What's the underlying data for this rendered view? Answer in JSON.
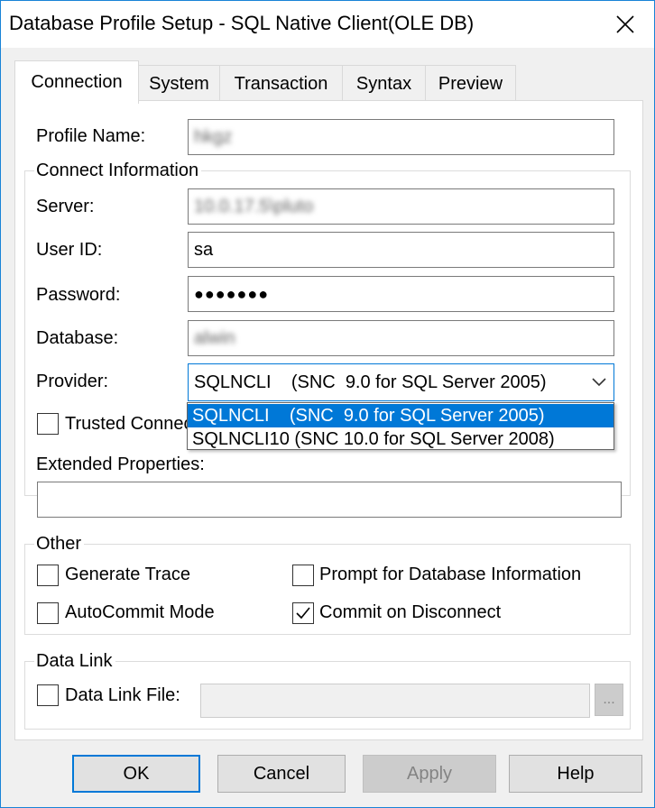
{
  "window": {
    "title": "Database Profile Setup - SQL Native Client(OLE DB)",
    "close_icon": "close-icon"
  },
  "tabs": [
    {
      "label": "Connection",
      "active": true
    },
    {
      "label": "System",
      "active": false
    },
    {
      "label": "Transaction",
      "active": false
    },
    {
      "label": "Syntax",
      "active": false
    },
    {
      "label": "Preview",
      "active": false
    }
  ],
  "profile": {
    "label": "Profile Name:",
    "value": "hkgz"
  },
  "connect_info": {
    "group_label": "Connect Information",
    "server_label": "Server:",
    "server_value": "10.0.17.5\\pluto",
    "userid_label": "User ID:",
    "userid_value": "sa",
    "password_label": "Password:",
    "password_value": "●●●●●●●",
    "database_label": "Database:",
    "database_value": "alwin",
    "provider_label": "Provider:",
    "provider_value": "SQLNCLI    (SNC  9.0 for SQL Server 2005)",
    "provider_options": [
      "SQLNCLI    (SNC  9.0 for SQL Server 2005)",
      "SQLNCLI10 (SNC 10.0 for SQL Server 2008)"
    ],
    "trusted_label": "Trusted Connection",
    "trusted_checked": false,
    "extended_label": "Extended Properties:",
    "extended_value": ""
  },
  "other": {
    "group_label": "Other",
    "generate_trace_label": "Generate Trace",
    "generate_trace_checked": false,
    "prompt_label": "Prompt for Database Information",
    "prompt_checked": false,
    "autocommit_label": "AutoCommit Mode",
    "autocommit_checked": false,
    "commit_disconnect_label": "Commit on Disconnect",
    "commit_disconnect_checked": true
  },
  "data_link": {
    "group_label": "Data Link",
    "file_label": "Data Link File:",
    "file_checked": false,
    "file_value": "",
    "browse_label": "..."
  },
  "buttons": {
    "ok": "OK",
    "cancel": "Cancel",
    "apply": "Apply",
    "help": "Help"
  },
  "colors": {
    "accent": "#0078d7",
    "window_border": "#1883d7",
    "dialog_bg": "#f0f0f0"
  }
}
